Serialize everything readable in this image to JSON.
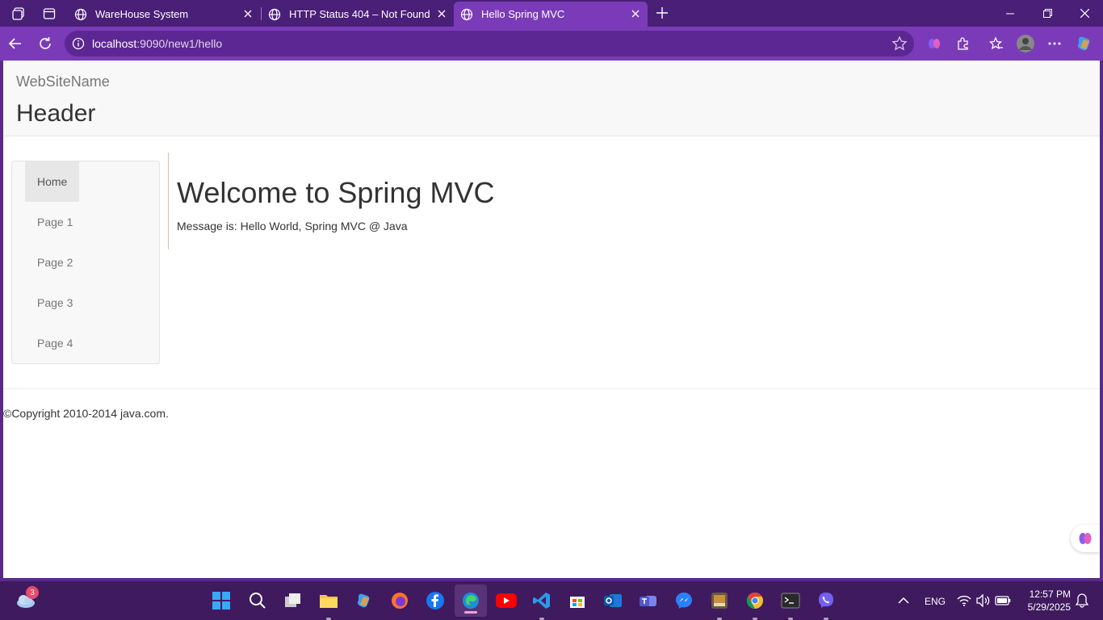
{
  "tabs": [
    {
      "title": "WareHouse System",
      "active": false
    },
    {
      "title": "HTTP Status 404 – Not Found",
      "active": false
    },
    {
      "title": "Hello Spring MVC",
      "active": true
    }
  ],
  "address_bar": {
    "host": "localhost",
    "path": ":9090/new1/hello"
  },
  "page": {
    "site_name": "WebSiteName",
    "header": "Header",
    "nav": [
      "Home",
      "Page 1",
      "Page 2",
      "Page 3",
      "Page 4"
    ],
    "nav_active": "Home",
    "title": "Welcome to Spring MVC",
    "message": "Message is: Hello World, Spring MVC @ Java",
    "footer": "©Copyright 2010-2014 java.com."
  },
  "taskbar": {
    "weather_badge": "3",
    "language": "ENG",
    "time": "12:57 PM",
    "date": "5/29/2025"
  },
  "colors": {
    "browser_accent": "#7b3bb8",
    "tabstrip": "#4a1f78",
    "taskbar": "#3f1a5e"
  }
}
